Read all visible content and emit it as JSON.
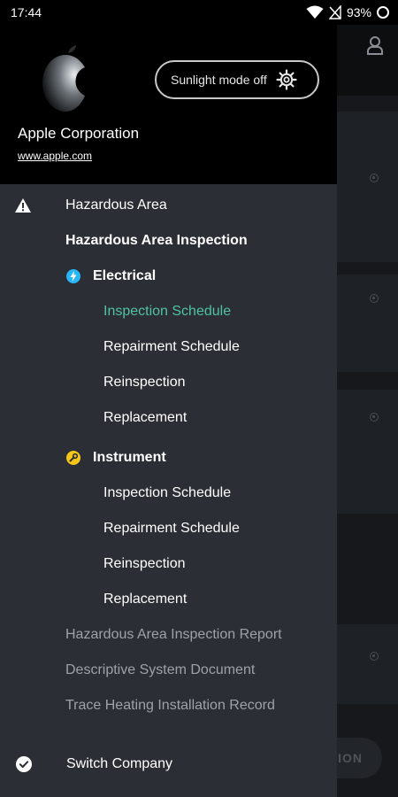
{
  "status_bar": {
    "time": "17:44",
    "battery": "93%",
    "icons": [
      "wifi-icon",
      "no-signal-icon",
      "battery-ring-icon"
    ]
  },
  "colors": {
    "drawer_bg": "#2b2e34",
    "header_bg": "#000000",
    "accent_teal": "#4fc3a1",
    "dim_text": "#9ea2a8",
    "electrical_icon": "#29b6f6",
    "instrument_icon": "#f5c518"
  },
  "drawer": {
    "header": {
      "company_name": "Apple Corporation",
      "company_url": "www.apple.com",
      "sunlight_toggle_label": "Sunlight mode off"
    },
    "menu": {
      "hazardous_area": "Hazardous Area",
      "inspection_section": "Hazardous Area Inspection",
      "electrical": {
        "label": "Electrical",
        "items": [
          "Inspection Schedule",
          "Repairment Schedule",
          "Reinspection",
          "Replacement"
        ],
        "selected_index": 0
      },
      "instrument": {
        "label": "Instrument",
        "items": [
          "Inspection Schedule",
          "Repairment Schedule",
          "Reinspection",
          "Replacement"
        ]
      },
      "inspection_report": "Hazardous Area Inspection Report",
      "system_document": "Descriptive System Document",
      "trace_heating": "Trace Heating Installation Record",
      "switch_company": "Switch Company"
    }
  },
  "background": {
    "action_button_partial": "ION"
  }
}
